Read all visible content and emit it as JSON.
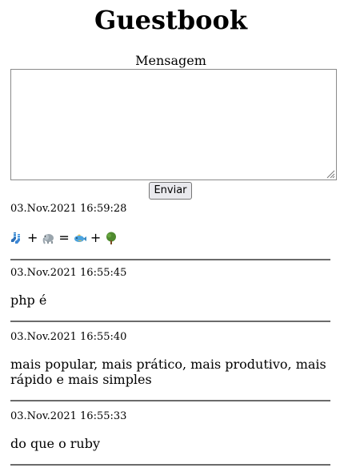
{
  "title": "Guestbook",
  "form": {
    "label": "Mensagem",
    "textarea_value": "",
    "submit_label": "Enviar"
  },
  "entries": [
    {
      "date": "03.Nov.2021 16:59:28",
      "message_parts": [
        "socks",
        "+",
        "elephant",
        "=",
        "fish",
        "+",
        "tree"
      ],
      "operators": [
        "+",
        "=",
        "+"
      ]
    },
    {
      "date": "03.Nov.2021 16:55:45",
      "message": "php é"
    },
    {
      "date": "03.Nov.2021 16:55:40",
      "message": "mais popular, mais prático, mais produtivo, mais rápido e mais simples"
    },
    {
      "date": "03.Nov.2021 16:55:33",
      "message": "do que o ruby"
    }
  ]
}
